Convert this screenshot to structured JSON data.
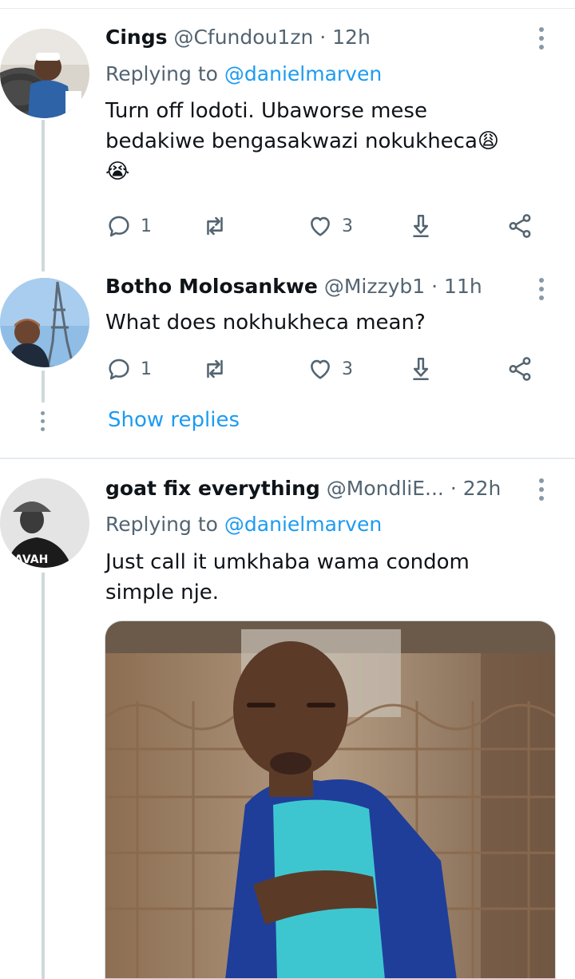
{
  "tweets": [
    {
      "name": "Cings",
      "handle": "@Cfundou1zn",
      "separator": "·",
      "time": "12h",
      "replying_prefix": "Replying to",
      "replying_to": "@danielmarven",
      "text_line1": "Turn off lodoti. Ubaworse mese",
      "text_line2": "bedakiwe bengasakwazi nokukheca😩",
      "text_line3": "😭",
      "reply_count": "1",
      "like_count": "3",
      "avatar_icon": "avatar-man-in-car"
    },
    {
      "name": "Botho Molosankwe",
      "handle": "@Mizzyb1",
      "separator": "·",
      "time": "11h",
      "text": "What does nokhukheca mean?",
      "reply_count": "1",
      "like_count": "3",
      "avatar_icon": "avatar-woman-eiffel-tower"
    },
    {
      "name": "goat fix everything",
      "handle": "@MondliE...",
      "separator": "·",
      "time": "22h",
      "replying_prefix": "Replying to",
      "replying_to": "@danielmarven",
      "text_line1": "Just call it umkhaba wama condom",
      "text_line2": "simple nje.",
      "avatar_icon": "avatar-man-bucket-hat",
      "media_icon": "man-blue-overalls-photo"
    }
  ],
  "show_replies_label": "Show replies",
  "colors": {
    "accent": "#1d9bf0",
    "secondary_text": "#536471",
    "thread_line": "#cfd9de",
    "icon_gray": "#536471"
  }
}
